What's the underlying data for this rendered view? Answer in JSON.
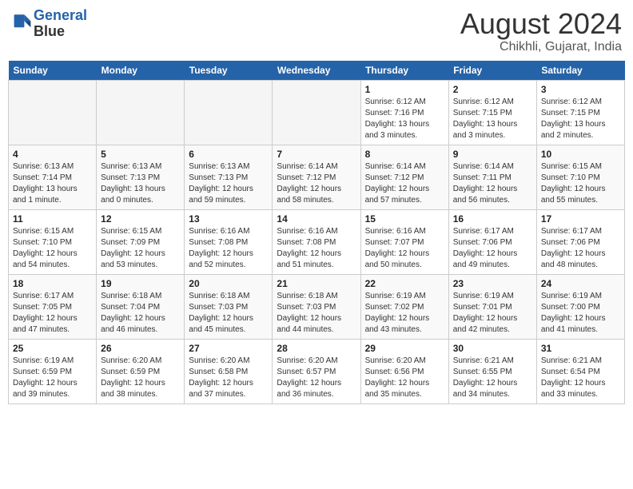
{
  "header": {
    "logo_line1": "General",
    "logo_line2": "Blue",
    "month_year": "August 2024",
    "location": "Chikhli, Gujarat, India"
  },
  "days_of_week": [
    "Sunday",
    "Monday",
    "Tuesday",
    "Wednesday",
    "Thursday",
    "Friday",
    "Saturday"
  ],
  "weeks": [
    [
      {
        "day": "",
        "empty": true
      },
      {
        "day": "",
        "empty": true
      },
      {
        "day": "",
        "empty": true
      },
      {
        "day": "",
        "empty": true
      },
      {
        "day": "1",
        "sunrise": "6:12 AM",
        "sunset": "7:16 PM",
        "daylight": "13 hours and 3 minutes."
      },
      {
        "day": "2",
        "sunrise": "6:12 AM",
        "sunset": "7:15 PM",
        "daylight": "13 hours and 3 minutes."
      },
      {
        "day": "3",
        "sunrise": "6:12 AM",
        "sunset": "7:15 PM",
        "daylight": "13 hours and 2 minutes."
      }
    ],
    [
      {
        "day": "4",
        "sunrise": "6:13 AM",
        "sunset": "7:14 PM",
        "daylight": "13 hours and 1 minute."
      },
      {
        "day": "5",
        "sunrise": "6:13 AM",
        "sunset": "7:13 PM",
        "daylight": "13 hours and 0 minutes."
      },
      {
        "day": "6",
        "sunrise": "6:13 AM",
        "sunset": "7:13 PM",
        "daylight": "12 hours and 59 minutes."
      },
      {
        "day": "7",
        "sunrise": "6:14 AM",
        "sunset": "7:12 PM",
        "daylight": "12 hours and 58 minutes."
      },
      {
        "day": "8",
        "sunrise": "6:14 AM",
        "sunset": "7:12 PM",
        "daylight": "12 hours and 57 minutes."
      },
      {
        "day": "9",
        "sunrise": "6:14 AM",
        "sunset": "7:11 PM",
        "daylight": "12 hours and 56 minutes."
      },
      {
        "day": "10",
        "sunrise": "6:15 AM",
        "sunset": "7:10 PM",
        "daylight": "12 hours and 55 minutes."
      }
    ],
    [
      {
        "day": "11",
        "sunrise": "6:15 AM",
        "sunset": "7:10 PM",
        "daylight": "12 hours and 54 minutes."
      },
      {
        "day": "12",
        "sunrise": "6:15 AM",
        "sunset": "7:09 PM",
        "daylight": "12 hours and 53 minutes."
      },
      {
        "day": "13",
        "sunrise": "6:16 AM",
        "sunset": "7:08 PM",
        "daylight": "12 hours and 52 minutes."
      },
      {
        "day": "14",
        "sunrise": "6:16 AM",
        "sunset": "7:08 PM",
        "daylight": "12 hours and 51 minutes."
      },
      {
        "day": "15",
        "sunrise": "6:16 AM",
        "sunset": "7:07 PM",
        "daylight": "12 hours and 50 minutes."
      },
      {
        "day": "16",
        "sunrise": "6:17 AM",
        "sunset": "7:06 PM",
        "daylight": "12 hours and 49 minutes."
      },
      {
        "day": "17",
        "sunrise": "6:17 AM",
        "sunset": "7:06 PM",
        "daylight": "12 hours and 48 minutes."
      }
    ],
    [
      {
        "day": "18",
        "sunrise": "6:17 AM",
        "sunset": "7:05 PM",
        "daylight": "12 hours and 47 minutes."
      },
      {
        "day": "19",
        "sunrise": "6:18 AM",
        "sunset": "7:04 PM",
        "daylight": "12 hours and 46 minutes."
      },
      {
        "day": "20",
        "sunrise": "6:18 AM",
        "sunset": "7:03 PM",
        "daylight": "12 hours and 45 minutes."
      },
      {
        "day": "21",
        "sunrise": "6:18 AM",
        "sunset": "7:03 PM",
        "daylight": "12 hours and 44 minutes."
      },
      {
        "day": "22",
        "sunrise": "6:19 AM",
        "sunset": "7:02 PM",
        "daylight": "12 hours and 43 minutes."
      },
      {
        "day": "23",
        "sunrise": "6:19 AM",
        "sunset": "7:01 PM",
        "daylight": "12 hours and 42 minutes."
      },
      {
        "day": "24",
        "sunrise": "6:19 AM",
        "sunset": "7:00 PM",
        "daylight": "12 hours and 41 minutes."
      }
    ],
    [
      {
        "day": "25",
        "sunrise": "6:19 AM",
        "sunset": "6:59 PM",
        "daylight": "12 hours and 39 minutes."
      },
      {
        "day": "26",
        "sunrise": "6:20 AM",
        "sunset": "6:59 PM",
        "daylight": "12 hours and 38 minutes."
      },
      {
        "day": "27",
        "sunrise": "6:20 AM",
        "sunset": "6:58 PM",
        "daylight": "12 hours and 37 minutes."
      },
      {
        "day": "28",
        "sunrise": "6:20 AM",
        "sunset": "6:57 PM",
        "daylight": "12 hours and 36 minutes."
      },
      {
        "day": "29",
        "sunrise": "6:20 AM",
        "sunset": "6:56 PM",
        "daylight": "12 hours and 35 minutes."
      },
      {
        "day": "30",
        "sunrise": "6:21 AM",
        "sunset": "6:55 PM",
        "daylight": "12 hours and 34 minutes."
      },
      {
        "day": "31",
        "sunrise": "6:21 AM",
        "sunset": "6:54 PM",
        "daylight": "12 hours and 33 minutes."
      }
    ]
  ]
}
